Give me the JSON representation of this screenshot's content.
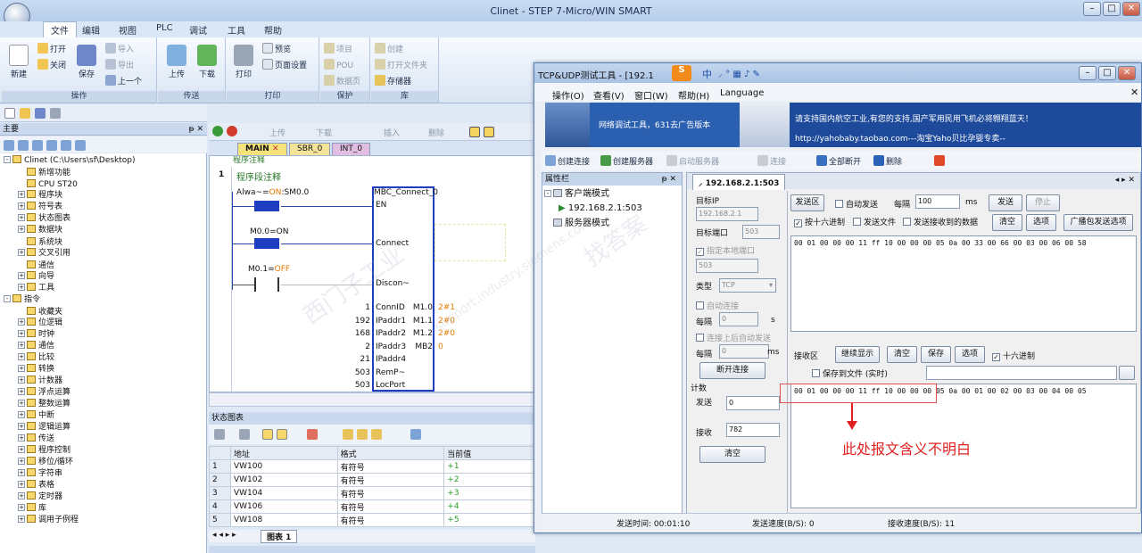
{
  "app": {
    "title": "Clinet - STEP 7-Micro/WIN SMART"
  },
  "menu": {
    "items": [
      "文件",
      "编辑",
      "视图",
      "PLC",
      "调试",
      "工具",
      "帮助"
    ],
    "active": "文件"
  },
  "ribbon": {
    "new": "新建",
    "open": "打开",
    "close": "关闭",
    "save": "保存",
    "import": "导入",
    "export": "导出",
    "previous": "上一个",
    "upload": "上传",
    "download": "下载",
    "print": "打印",
    "preview": "预览",
    "page_setup": "页面设置",
    "project": "项目",
    "pou": "POU",
    "data_page": "数据页",
    "create": "创建",
    "open_folder": "打开文件夹",
    "memory": "存储器",
    "groups": {
      "ops": "操作",
      "transfer": "传送",
      "print": "打印",
      "protect": "保护",
      "lib": "库"
    }
  },
  "nav": {
    "title": "主要",
    "items": [
      {
        "label": "Clinet (C:\\Users\\sf\\Desktop)",
        "indent": 0,
        "box": "-"
      },
      {
        "label": "新增功能",
        "indent": 1,
        "box": ""
      },
      {
        "label": "CPU ST20",
        "indent": 1,
        "box": ""
      },
      {
        "label": "程序块",
        "indent": 1,
        "box": "+"
      },
      {
        "label": "符号表",
        "indent": 1,
        "box": "+"
      },
      {
        "label": "状态图表",
        "indent": 1,
        "box": "+"
      },
      {
        "label": "数据块",
        "indent": 1,
        "box": "+"
      },
      {
        "label": "系统块",
        "indent": 1,
        "box": ""
      },
      {
        "label": "交叉引用",
        "indent": 1,
        "box": "+"
      },
      {
        "label": "通信",
        "indent": 1,
        "box": ""
      },
      {
        "label": "向导",
        "indent": 1,
        "box": "+"
      },
      {
        "label": "工具",
        "indent": 1,
        "box": "+"
      },
      {
        "label": "指令",
        "indent": 0,
        "box": "-"
      },
      {
        "label": "收藏夹",
        "indent": 1,
        "box": ""
      },
      {
        "label": "位逻辑",
        "indent": 1,
        "box": "+"
      },
      {
        "label": "时钟",
        "indent": 1,
        "box": "+"
      },
      {
        "label": "通信",
        "indent": 1,
        "box": "+"
      },
      {
        "label": "比较",
        "indent": 1,
        "box": "+"
      },
      {
        "label": "转换",
        "indent": 1,
        "box": "+"
      },
      {
        "label": "计数器",
        "indent": 1,
        "box": "+"
      },
      {
        "label": "浮点运算",
        "indent": 1,
        "box": "+"
      },
      {
        "label": "整数运算",
        "indent": 1,
        "box": "+"
      },
      {
        "label": "中断",
        "indent": 1,
        "box": "+"
      },
      {
        "label": "逻辑运算",
        "indent": 1,
        "box": "+"
      },
      {
        "label": "传送",
        "indent": 1,
        "box": "+"
      },
      {
        "label": "程序控制",
        "indent": 1,
        "box": "+"
      },
      {
        "label": "移位/循环",
        "indent": 1,
        "box": "+"
      },
      {
        "label": "字符串",
        "indent": 1,
        "box": "+"
      },
      {
        "label": "表格",
        "indent": 1,
        "box": "+"
      },
      {
        "label": "定时器",
        "indent": 1,
        "box": "+"
      },
      {
        "label": "库",
        "indent": 1,
        "box": "+"
      },
      {
        "label": "调用子例程",
        "indent": 1,
        "box": "+"
      }
    ]
  },
  "editor": {
    "toolbar": {
      "upload": "上传",
      "download": "下载",
      "insert": "插入",
      "delete": "删除"
    },
    "tabs": [
      "MAIN",
      "SBR_0",
      "INT_0"
    ],
    "net_comment_top": "程序注释",
    "network_no": "1",
    "network_comment": "程序段注释",
    "contact1": "Alwa~=ON:SM0.0",
    "contact1_state": "ON",
    "contact2": "M0.0=ON",
    "contact3": "M0.1=OFF",
    "block_title": "MBC_Connect_0",
    "en": "EN",
    "connect": "Connect",
    "discon": "Discon~",
    "inputs": [
      {
        "val": "1",
        "pin": "ConnID"
      },
      {
        "val": "192",
        "pin": "IPaddr1"
      },
      {
        "val": "168",
        "pin": "IPaddr2"
      },
      {
        "val": "2",
        "pin": "IPaddr3"
      },
      {
        "val": "21",
        "pin": "IPaddr4"
      },
      {
        "val": "503",
        "pin": "RemP~"
      },
      {
        "val": "503",
        "pin": "LocPort"
      }
    ],
    "outputs": [
      {
        "pin": "M1.0",
        "val": "2#1"
      },
      {
        "pin": "M1.1",
        "val": "2#0"
      },
      {
        "pin": "M1.2",
        "val": "2#0"
      },
      {
        "pin": "MB2",
        "val": "0"
      }
    ]
  },
  "status_chart": {
    "title": "状态图表",
    "headers": [
      "",
      "地址",
      "格式",
      "当前值"
    ],
    "rows": [
      [
        "1",
        "VW100",
        "有符号",
        "+1"
      ],
      [
        "2",
        "VW102",
        "有符号",
        "+2"
      ],
      [
        "3",
        "VW104",
        "有符号",
        "+3"
      ],
      [
        "4",
        "VW106",
        "有符号",
        "+4"
      ],
      [
        "5",
        "VW108",
        "有符号",
        "+5"
      ]
    ],
    "sheet_tab": "图表 1"
  },
  "tcp": {
    "title": "TCP&UDP测试工具 - [192.1",
    "menu": [
      "操作(O)",
      "查看(V)",
      "窗口(W)",
      "帮助(H)",
      "Language"
    ],
    "banner_left": "网络调试工具，631去广告版本",
    "banner_right1": "请支持国内航空工业,有您的支持,国产军用民用飞机必将翱翔蓝天！",
    "banner_right2": "http://yahobaby.taobao.com---淘宝Yaho贝比孕婴专卖--",
    "toolbar": {
      "create_conn": "创建连接",
      "create_server": "创建服务器",
      "start_server": "启动服务器",
      "connect": "连接",
      "disconnect_all": "全部断开",
      "delete": "删除"
    },
    "prop_title": "属性栏",
    "client_mode": "客户端模式",
    "client_entry": "192.168.2.1:503",
    "server_mode": "服务器模式",
    "conn_tab": "192.168.2.1:503",
    "target_ip_label": "目标IP",
    "target_ip": "192.168.2.1",
    "target_port_label": "目标端口",
    "target_port": "503",
    "specify_local": "指定本地端口",
    "local_port": "503",
    "type_label": "类型",
    "type_value": "TCP",
    "auto_connect": "自动连接",
    "every1": "每隔",
    "every1_val": "0",
    "unit_s": "s",
    "auto_send_after": "连接上后自动发送",
    "every2": "每隔",
    "every2_val": "0",
    "unit_ms": "ms",
    "disconnect_btn": "断开连接",
    "count_label": "计数",
    "send_label": "发送",
    "send_count": "0",
    "recv_label": "接收",
    "recv_count": "782",
    "clear_btn": "清空",
    "send_area": "发送区",
    "auto_send": "自动发送",
    "every3": "每隔",
    "every3_val": "100",
    "unit_ms2": "ms",
    "send_btn": "发送",
    "stop_btn": "停止",
    "hex_send": "按十六进制",
    "send_file": "发送文件",
    "send_received": "发送接收到的数据",
    "clear2": "清空",
    "options": "选项",
    "broadcast": "广播包发送选项",
    "send_data": "00 01 00 00 00 11 ff 10 00 00 00 05 0a 00 33 00 66 00 03 00 06 00 58",
    "recv_area": "接收区",
    "continue_show": "继续显示",
    "clear3": "清空",
    "save": "保存",
    "options2": "选项",
    "hex_recv": "十六进制",
    "save_file": "保存到文件 (实时)",
    "recv_data": "00 01 00 00 00 11 ff 10 00 00 00 05 0a 00 01 00 02 00 03 00 04 00 05",
    "annotation": "此处报文含义不明白",
    "send_time": "发送时间: 00:01:10",
    "send_speed": "发送速度(B/S): 0",
    "recv_speed": "接收速度(B/S): 11"
  },
  "ime": {
    "label": "中"
  },
  "watermark": {
    "line1": "西门子工业",
    "line2": "support.industry.siemens.com",
    "line3": "找答案"
  },
  "colors": {
    "accent": "#1d3fbf",
    "annotation_red": "#e02020",
    "ladder_line": "#2847a8"
  }
}
